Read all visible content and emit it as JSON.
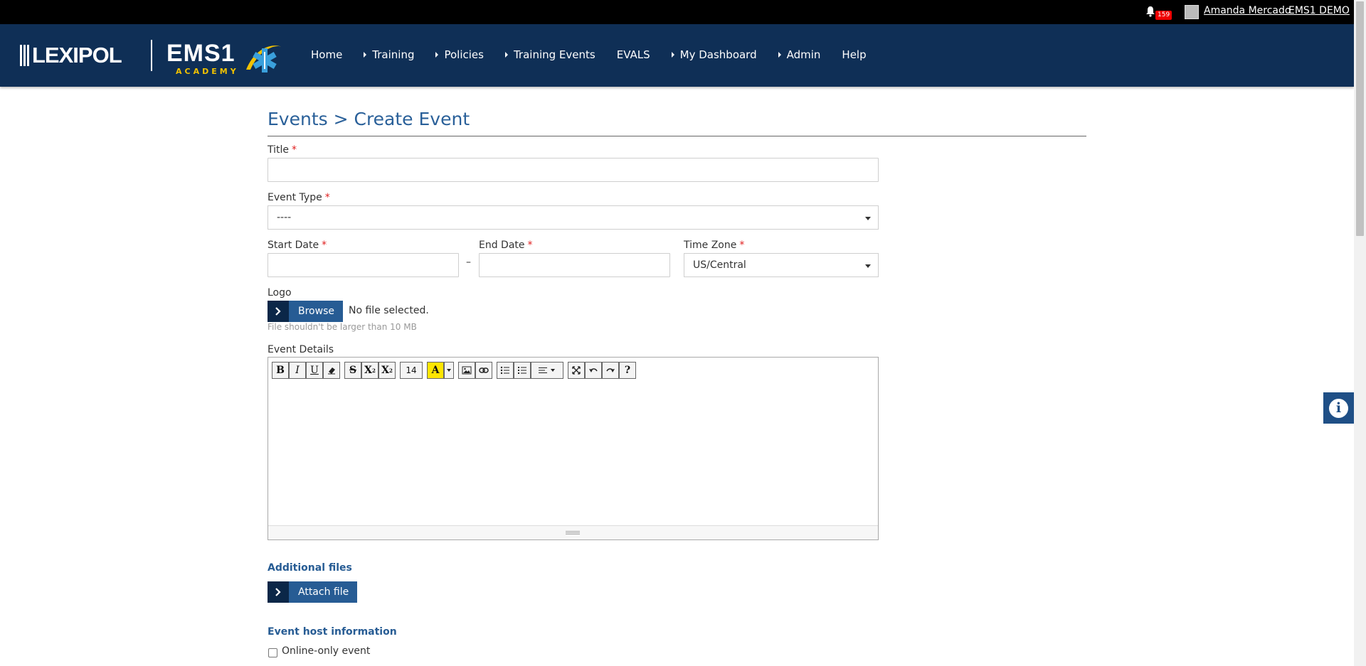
{
  "topbar": {
    "notification_count": "159",
    "user_name": "Amanda Mercado",
    "org_name": "EMS1 DEMO"
  },
  "branding": {
    "lexipol": "LEXIPOL",
    "ems": "EMS1",
    "academy": "ACADEMY"
  },
  "nav": {
    "home": "Home",
    "training": "Training",
    "policies": "Policies",
    "training_events": "Training Events",
    "evals": "EVALS",
    "my_dashboard": "My Dashboard",
    "admin": "Admin",
    "help": "Help"
  },
  "page": {
    "title": "Events > Create Event"
  },
  "form": {
    "title_label": "Title",
    "title_value": "",
    "event_type_label": "Event Type",
    "event_type_value": "----",
    "start_date_label": "Start Date",
    "end_date_label": "End Date",
    "date_separator": "–",
    "time_zone_label": "Time Zone",
    "time_zone_value": "US/Central",
    "logo_label": "Logo",
    "browse_label": "Browse",
    "no_file_text": "No file selected.",
    "file_hint": "File shouldn't be larger than 10 MB",
    "event_details_label": "Event Details",
    "font_size_value": "14",
    "additional_files_heading": "Additional files",
    "attach_file_label": "Attach file",
    "host_info_heading": "Event host information",
    "online_only_label": "Online-only event",
    "required_mark": "*"
  },
  "colors": {
    "header_bg": "#0f2f56",
    "accent": "#275c94",
    "title_blue": "#2a6099",
    "required": "#e02020",
    "badge": "#ee0000"
  }
}
